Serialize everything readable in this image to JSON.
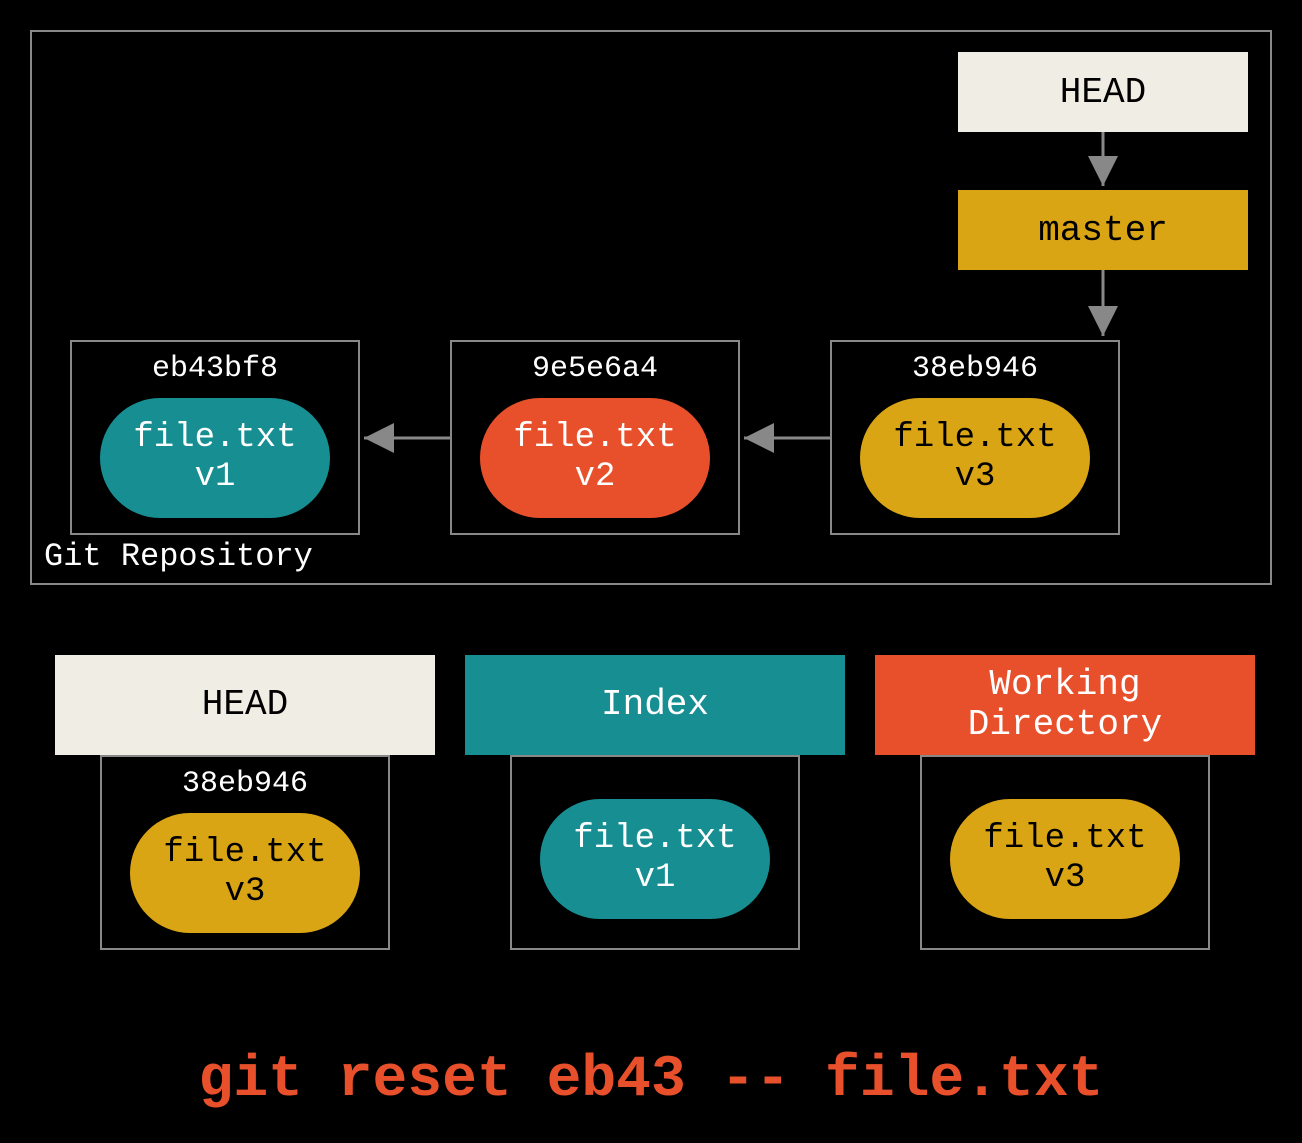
{
  "repo": {
    "label": "Git Repository",
    "head_label": "HEAD",
    "master_label": "master",
    "commits": [
      {
        "hash": "eb43bf8",
        "file": "file.txt",
        "version": "v1",
        "color": "teal"
      },
      {
        "hash": "9e5e6a4",
        "file": "file.txt",
        "version": "v2",
        "color": "orange"
      },
      {
        "hash": "38eb946",
        "file": "file.txt",
        "version": "v3",
        "color": "gold"
      }
    ]
  },
  "areas": {
    "head": {
      "label": "HEAD",
      "hash": "38eb946",
      "file": "file.txt",
      "version": "v3",
      "color": "gold"
    },
    "index": {
      "label": "Index",
      "file": "file.txt",
      "version": "v1",
      "color": "teal"
    },
    "wd": {
      "label": "Working\nDirectory",
      "file": "file.txt",
      "version": "v3",
      "color": "gold"
    }
  },
  "command": "git reset eb43 -- file.txt",
  "colors": {
    "teal": "#178e92",
    "orange": "#e8502c",
    "gold": "#d9a514",
    "cream": "#f0ede4"
  }
}
